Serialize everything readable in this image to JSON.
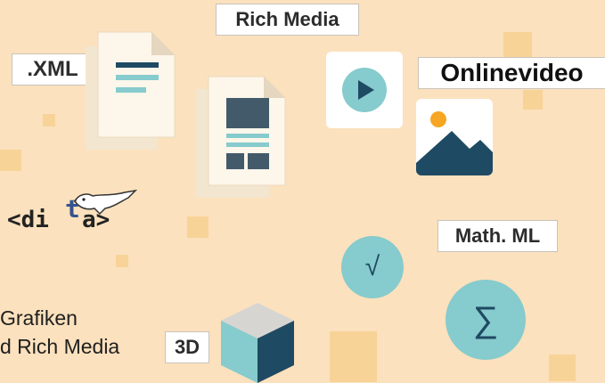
{
  "labels": {
    "rich_media": "Rich Media",
    "xml": ".XML",
    "onlinevideo": "Onlinevideo",
    "mathml": "Math. ML",
    "three_d": "3D"
  },
  "dita_logo": {
    "prefix": "<di",
    "raised_letter": "t",
    "suffix": "a>"
  },
  "caption": {
    "line1": "Grafiken",
    "line2": "d Rich Media"
  },
  "math_symbols": {
    "sqrt": "√",
    "sum": "∑"
  },
  "icons": {
    "document": "document-stack-icon",
    "layout": "layout-document-icon",
    "video": "play-icon",
    "image": "image-icon",
    "sqrt": "square-root-icon",
    "sum": "sigma-icon",
    "cube": "cube-icon",
    "bird": "bird-icon"
  },
  "colors": {
    "background": "#fbe1bd",
    "accent_square": "#f8d398",
    "teal": "#86cbcd",
    "navy": "#1f4a63",
    "document": "#fdf6ea"
  }
}
